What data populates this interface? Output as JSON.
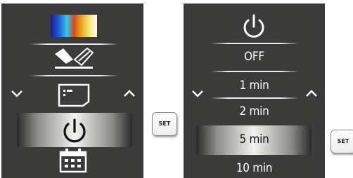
{
  "left_menu": {
    "items": [
      {
        "icon": "color-palette-icon"
      },
      {
        "icon": "measurement-icon"
      },
      {
        "icon": "display-card-icon"
      },
      {
        "icon": "power-icon",
        "selected": true
      },
      {
        "icon": "calendar-icon"
      }
    ],
    "nav_left_icon": "chevron-down-icon",
    "nav_right_icon": "chevron-up-icon"
  },
  "right_menu": {
    "header_icon": "power-icon",
    "options": [
      {
        "label": "OFF"
      },
      {
        "label": "1 min"
      },
      {
        "label": "2 min"
      },
      {
        "label": "5 min",
        "selected": true
      },
      {
        "label": "10 min"
      }
    ],
    "nav_left_icon": "chevron-down-icon",
    "nav_right_icon": "chevron-up-icon"
  },
  "buttons": {
    "set_left": "SET",
    "set_right": "SET"
  },
  "colors": {
    "panel_bg": "#3b3b39",
    "text": "#ffffff",
    "selected_text": "#111111"
  }
}
